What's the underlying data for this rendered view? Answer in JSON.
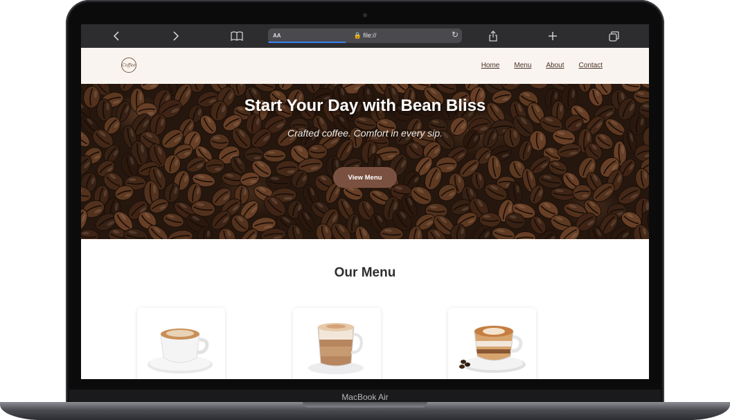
{
  "device": {
    "label": "MacBook Air"
  },
  "browser": {
    "text_size_label": "AA",
    "url": "file://",
    "icons": [
      "back-icon",
      "forward-icon",
      "bookmarks-icon",
      "reload-icon",
      "share-icon",
      "new-tab-icon",
      "tabs-icon"
    ]
  },
  "site": {
    "logo_text": "Coffee",
    "nav": [
      "Home",
      "Menu",
      "About",
      "Contact"
    ],
    "hero": {
      "title": "Start Your Day with Bean Bliss",
      "subtitle": "Crafted coffee. Comfort in every sip.",
      "cta_label": "View Menu"
    },
    "menu_section": {
      "title": "Our Menu",
      "items": [
        {
          "image": "cappuccino-cup"
        },
        {
          "image": "latte-glass"
        },
        {
          "image": "latte-art-cup"
        }
      ]
    }
  },
  "colors": {
    "header_bg": "#f9f4ef",
    "nav_text": "#4a3226",
    "cta_bg": "#7a5140",
    "toolbar_bg": "#2d2d2f"
  }
}
